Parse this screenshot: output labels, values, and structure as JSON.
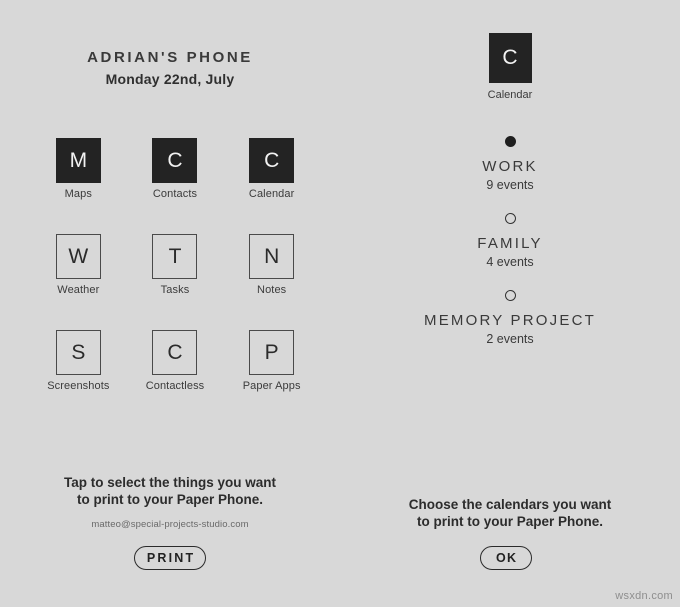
{
  "background_color": "#d8d8d8",
  "accent_color": "#232323",
  "left_panel": {
    "title": "ADRIAN'S PHONE",
    "date": "Monday 22nd, July",
    "apps": [
      {
        "letter": "M",
        "label": "Maps",
        "selected": true
      },
      {
        "letter": "C",
        "label": "Contacts",
        "selected": true
      },
      {
        "letter": "C",
        "label": "Calendar",
        "selected": true
      },
      {
        "letter": "W",
        "label": "Weather",
        "selected": false
      },
      {
        "letter": "T",
        "label": "Tasks",
        "selected": false
      },
      {
        "letter": "N",
        "label": "Notes",
        "selected": false
      },
      {
        "letter": "S",
        "label": "Screenshots",
        "selected": false
      },
      {
        "letter": "C",
        "label": "Contactless",
        "selected": false
      },
      {
        "letter": "P",
        "label": "Paper Apps",
        "selected": false
      }
    ],
    "instructions_line1": "Tap to select the things you want",
    "instructions_line2": "to print to your Paper Phone.",
    "email": "matteo@special-projects-studio.com",
    "print_button": "PRINT"
  },
  "right_panel": {
    "app": {
      "letter": "C",
      "label": "Calendar"
    },
    "calendars": [
      {
        "name": "WORK",
        "events": "9 events",
        "selected": true
      },
      {
        "name": "FAMILY",
        "events": "4 events",
        "selected": false
      },
      {
        "name": "MEMORY PROJECT",
        "events": "2 events",
        "selected": false
      }
    ],
    "instructions_line1": "Choose the calendars you want",
    "instructions_line2": "to print to your Paper Phone.",
    "ok_button": "OK"
  },
  "watermark": "wsxdn.com"
}
